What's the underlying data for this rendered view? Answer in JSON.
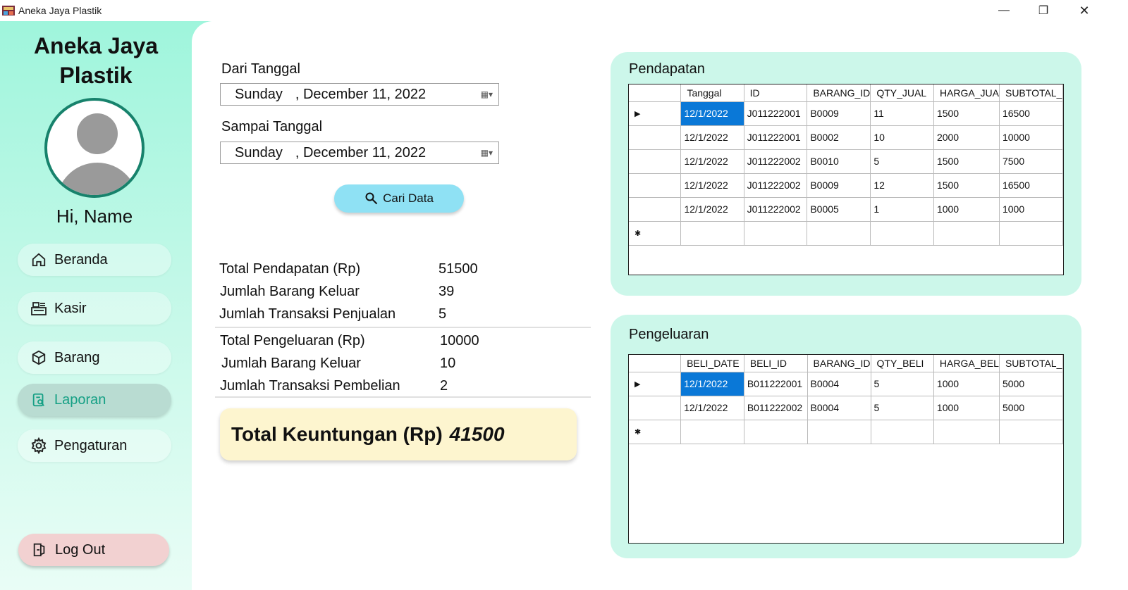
{
  "window": {
    "title": "Aneka Jaya Plastik",
    "minimize": "—",
    "maximize": "❐",
    "close": "✕"
  },
  "sidebar": {
    "brand": "Aneka Jaya Plastik",
    "greeting": "Hi, Name",
    "items": [
      {
        "label": "Beranda",
        "icon": "home-icon"
      },
      {
        "label": "Kasir",
        "icon": "cashier-icon"
      },
      {
        "label": "Barang",
        "icon": "box-icon"
      },
      {
        "label": "Laporan",
        "icon": "report-icon",
        "active": true
      },
      {
        "label": "Pengaturan",
        "icon": "gear-icon"
      }
    ],
    "logout": "Log Out"
  },
  "filter": {
    "from_label": "Dari Tanggal",
    "from_day": "Sunday",
    "from_date": ", December  11, 2022",
    "to_label": "Sampai Tanggal",
    "to_day": "Sunday",
    "to_date": ", December  11, 2022",
    "search_button": "Cari Data"
  },
  "summary": {
    "income": [
      {
        "label": "Total Pendapatan (Rp)",
        "value": "51500"
      },
      {
        "label": "Jumlah Barang Keluar",
        "value": "39"
      },
      {
        "label": "Jumlah Transaksi Penjualan",
        "value": "5"
      }
    ],
    "expense": [
      {
        "label": "Total Pengeluaran (Rp)",
        "value": "10000"
      },
      {
        "label": "Jumlah Barang Keluar",
        "value": "10"
      },
      {
        "label": "Jumlah Transaksi Pembelian",
        "value": "2"
      }
    ],
    "profit_label": "Total Keuntungan (Rp)",
    "profit_value": "41500"
  },
  "pendapatan": {
    "title": "Pendapatan",
    "columns": [
      "Tanggal",
      "ID",
      "BARANG_ID",
      "QTY_JUAL",
      "HARGA_JUA",
      "SUBTOTAL_"
    ],
    "rows": [
      [
        "12/1/2022",
        "J011222001",
        "B0009",
        "11",
        "1500",
        "16500"
      ],
      [
        "12/1/2022",
        "J011222001",
        "B0002",
        "10",
        "2000",
        "10000"
      ],
      [
        "12/1/2022",
        "J011222002",
        "B0010",
        "5",
        "1500",
        "7500"
      ],
      [
        "12/1/2022",
        "J011222002",
        "B0009",
        "12",
        "1500",
        "16500"
      ],
      [
        "12/1/2022",
        "J011222002",
        "B0005",
        "1",
        "1000",
        "1000"
      ]
    ]
  },
  "pengeluaran": {
    "title": "Pengeluaran",
    "columns": [
      "BELI_DATE",
      "BELI_ID",
      "BARANG_ID",
      "QTY_BELI",
      "HARGA_BEL",
      "SUBTOTAL_"
    ],
    "rows": [
      [
        "12/1/2022",
        "B011222001",
        "B0004",
        "5",
        "1000",
        "5000"
      ],
      [
        "12/1/2022",
        "B011222002",
        "B0004",
        "5",
        "1000",
        "5000"
      ]
    ]
  },
  "colors": {
    "accent": "#16a085",
    "selection": "#0a78d7",
    "panel": "#ccf7ea",
    "sidebar": "#9ff5dc"
  }
}
